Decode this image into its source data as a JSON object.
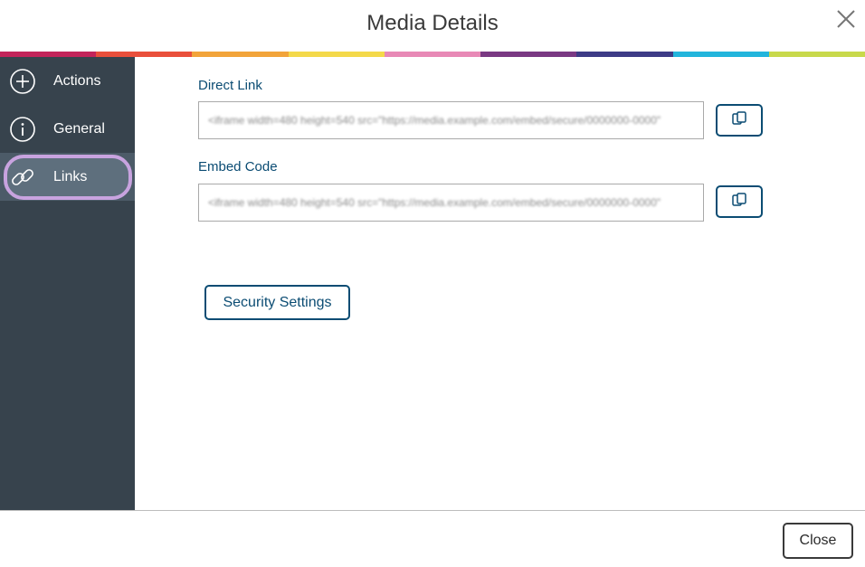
{
  "dialog": {
    "title": "Media Details",
    "close_icon": "close-x-icon"
  },
  "stripe_colors": [
    "#c3245a",
    "#e94f3b",
    "#f2a43a",
    "#f4d94a",
    "#e889b6",
    "#7a3983",
    "#3d3b86",
    "#22b5dc",
    "#c8d94b"
  ],
  "sidebar": {
    "items": [
      {
        "label": "Actions",
        "icon": "plus-circle-icon"
      },
      {
        "label": "General",
        "icon": "info-circle-icon"
      },
      {
        "label": "Links",
        "icon": "link-icon",
        "active": true
      }
    ]
  },
  "links": {
    "direct_link_label": "Direct Link",
    "direct_link_value": "<iframe width=480 height=540 src=\"https://media.example.com/embed/secure/0000000-0000\"",
    "embed_code_label": "Embed Code",
    "embed_code_value": "<iframe width=480 height=540 src=\"https://media.example.com/embed/secure/0000000-0000\"",
    "copy_icon": "copy-icon",
    "security_settings_label": "Security Settings"
  },
  "footer": {
    "close_label": "Close"
  },
  "colors": {
    "sidebar_bg": "#37434d",
    "accent": "#0b4c73",
    "active_highlight": "#c8a3df"
  }
}
